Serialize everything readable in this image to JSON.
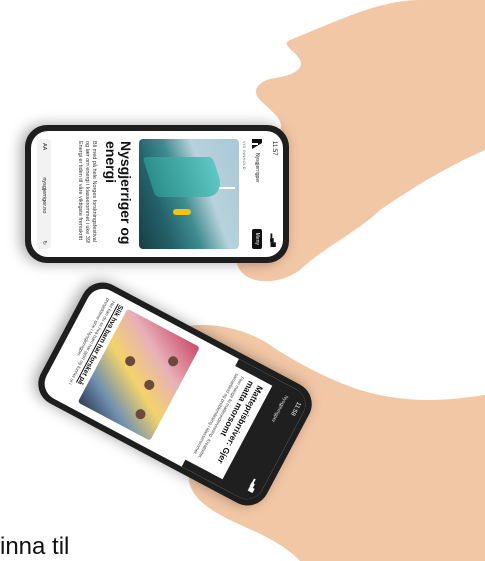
{
  "phone1": {
    "status": {
      "time": "11:57",
      "signal": "▂▄▆",
      "battery": "▭"
    },
    "brand": "Nysgjerrigper",
    "menu": "Meny",
    "crumb": "VIS INNHOLD",
    "headline": "Nysgjerriger og energi",
    "lead": "Bli med på hele Norges forskningsfestival og lær om energi i klasserommet i uke 39! Energi er tiden til våre viktigste fremskritt",
    "address": "nysgjerriger.no",
    "aA": "AA",
    "reload": "↻"
  },
  "phone2": {
    "status": {
      "time": "11:58",
      "signal": "▂▄▆",
      "battery": "▭"
    },
    "brand": "Nysgjerrigper",
    "card1_title": "Matteprisbrriver: Gjer matta morsomt",
    "card1_text": "Finn mange fri matteundervisning. Kreativitet, samarbeid og problemløsing i klasserommet.",
    "card2_title": "Slik hva barn har forsket på",
    "card2_text": "Her kan du se hva barn har gjort og funnet ut i prosjektene sine i Nysgjerrigper."
  },
  "bottom_text": "inna til"
}
